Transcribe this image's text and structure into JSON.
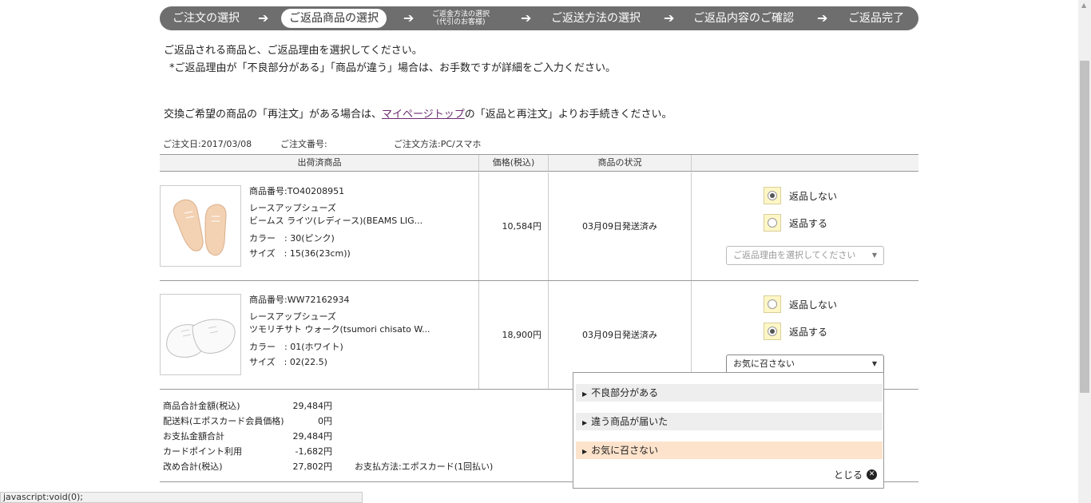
{
  "steps": {
    "step1": "ご注文の選択",
    "step2": "ご返品商品の選択",
    "step3_line1": "ご返金方法の選択",
    "step3_line2": "(代引のお客様)",
    "step4": "ご返送方法の選択",
    "step5": "ご返品内容のご確認",
    "step6": "ご返品完了",
    "arrow": "➔"
  },
  "messages": {
    "line1": "ご返品される商品と、ご返品理由を選択してください。",
    "line2": "*ご返品理由が「不良部分がある」「商品が違う」場合は、お手数ですが詳細をご入力ください。",
    "line3_pre": "交換ご希望の商品の「再注文」がある場合は、",
    "line3_link": "マイページトップ",
    "line3_post": "の「返品と再注文」よりお手続きください。"
  },
  "order": {
    "date": "ご注文日:2017/03/08",
    "number": "ご注文番号:",
    "method": "ご注文方法:PC/スマホ"
  },
  "table": {
    "headers": [
      "出荷済商品",
      "価格(税込)",
      "商品の状況"
    ]
  },
  "items": [
    {
      "code": "商品番号:TO40208951",
      "category": "レースアップシューズ",
      "name": "ビームス ライツ(レディース)(BEAMS LIG...",
      "color": "カラー　: 30(ピンク)",
      "size": "サイズ　: 15(36(23cm))",
      "price": "10,584円",
      "status": "03月09日発送済み",
      "no_return": "返品しない",
      "return": "返品する",
      "selected": "no_return",
      "reason_placeholder": "ご返品理由を選択してください"
    },
    {
      "code": "商品番号:WW72162934",
      "category": "レースアップシューズ",
      "name": "ツモリチサト ウォーク(tsumori chisato W...",
      "color": "カラー　: 01(ホワイト)",
      "size": "サイズ　: 02(22.5)",
      "price": "18,900円",
      "status": "03月09日発送済み",
      "no_return": "返品しない",
      "return": "返品する",
      "selected": "return",
      "reason_value": "お気に召さない"
    }
  ],
  "dropdown": {
    "options": [
      "不良部分がある",
      "違う商品が届いた",
      "お気に召さない"
    ],
    "selected_index": 2,
    "close_label": "とじる"
  },
  "summary": {
    "rows": [
      {
        "label": "商品合計金額(税込)",
        "value": "29,484円"
      },
      {
        "label": "配送料(エポスカード会員価格)",
        "value": "0円"
      },
      {
        "label": "お支払金額合計",
        "value": "29,484円"
      },
      {
        "label": "カードポイント利用",
        "value": "-1,682円"
      },
      {
        "label": "改め合計(税込)",
        "value": "27,802円"
      }
    ],
    "payment_method": "お支払方法:エポスカード(1回払い)"
  },
  "statusbar": "javascript:void(0);",
  "colors": {
    "steps_bg": "#6e6e6e",
    "link": "#6a2b6d",
    "radio_bg": "#fff6c6",
    "selected_option": "#fde3cc"
  }
}
